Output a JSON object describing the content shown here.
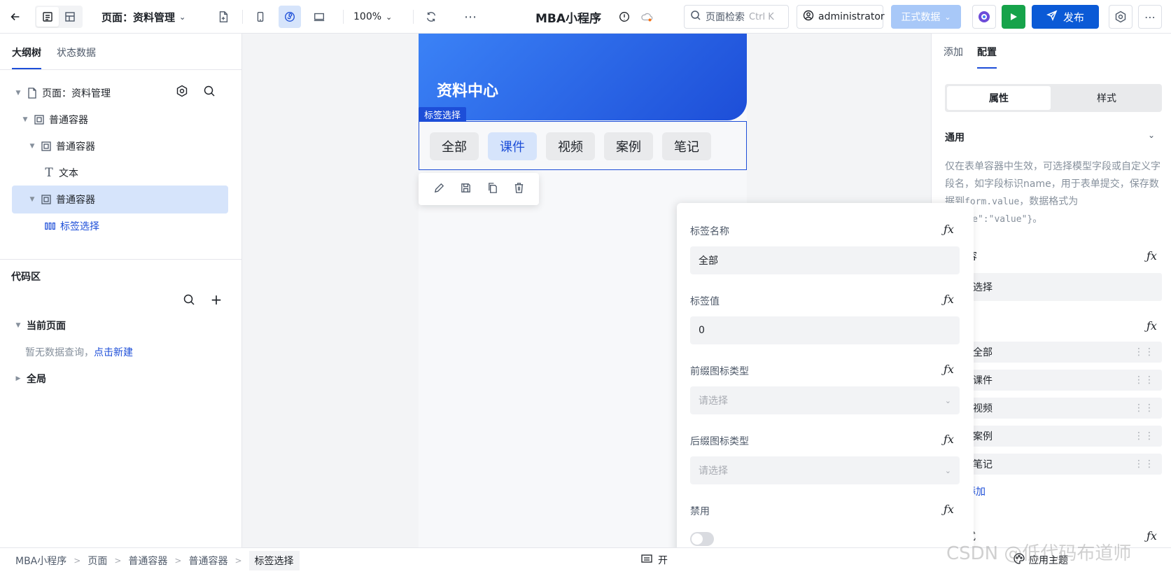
{
  "topbar": {
    "page_title": "页面：资料管理",
    "zoom": "100%",
    "app_title": "MBA小程序",
    "search_placeholder": "页面检索",
    "search_shortcut": "Ctrl K",
    "user": "administrator",
    "data_mode": "正式数据",
    "publish": "发布"
  },
  "left": {
    "tabs": [
      "大纲树",
      "状态数据"
    ],
    "tree": [
      {
        "label": "页面：资料管理"
      },
      {
        "label": "普通容器"
      },
      {
        "label": "普通容器"
      },
      {
        "label": "文本"
      },
      {
        "label": "普通容器"
      },
      {
        "label": "标签选择"
      }
    ],
    "code_title": "代码区",
    "current_page": "当前页面",
    "empty_hint": "暂无数据查询，",
    "create_link": "点击新建",
    "global": "全局"
  },
  "canvas": {
    "banner_title": "资料中心",
    "selected_tag": "标签选择",
    "chips": [
      "全部",
      "课件",
      "视频",
      "案例",
      "笔记"
    ],
    "active_chip": "课件"
  },
  "popover": {
    "fields": [
      {
        "label": "标签名称",
        "value": "全部",
        "fx": "ƒx"
      },
      {
        "label": "标签值",
        "value": "0",
        "fx": "ƒx"
      },
      {
        "label": "前缀图标类型",
        "placeholder": "请选择",
        "fx": "ƒx"
      },
      {
        "label": "后缀图标类型",
        "placeholder": "请选择",
        "fx": "ƒx"
      },
      {
        "label": "禁用",
        "fx": "ƒx"
      }
    ],
    "disabled_on": false
  },
  "right": {
    "tabs": [
      "添加",
      "配置"
    ],
    "seg": [
      "属性",
      "样式"
    ],
    "section": "通用",
    "desc1": "仅在表单容器中生效，可选择模型字段或自定义字段名，如字段标识name，用于表单提交，保存数据到",
    "desc_code1": "form.value",
    "desc2": "，数据格式为",
    "desc_code2": "{\"name\":\"value\"}",
    "desc3": "。",
    "content_label": "容",
    "content_value": "选择",
    "options": [
      "全部",
      "课件",
      "视频",
      "案例",
      "笔记"
    ],
    "add_label": "添加",
    "style_label": "式",
    "fx": "ƒx"
  },
  "bottom": {
    "crumbs": [
      "MBA小程序",
      "页面",
      "普通容器",
      "普通容器",
      "标签选择"
    ],
    "toggle_label": "开",
    "apply_theme": "应用主题"
  },
  "watermark": "CSDN @低代码布道师"
}
